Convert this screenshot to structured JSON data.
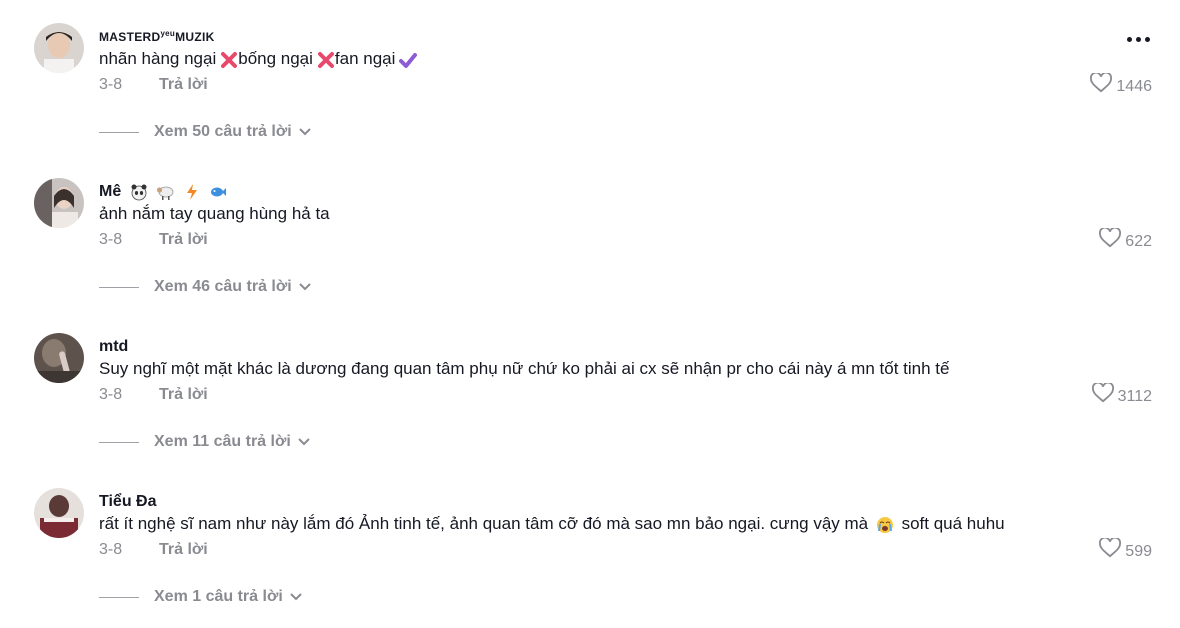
{
  "comments": [
    {
      "username": "MASTERD",
      "username_sup": "yeu",
      "username_tail": "MUZIK",
      "text_parts": [
        "nhãn hàng ngại",
        "bống ngại",
        "fan ngại"
      ],
      "date": "3-8",
      "reply_label": "Trả lời",
      "likes": "1446",
      "view_replies": "Xem 50 câu trả lời",
      "emojis": [
        "cross-mark",
        "cross-mark",
        "check-mark"
      ]
    },
    {
      "username": "Mê",
      "username_emojis": [
        "panda",
        "sheep",
        "lightning",
        "fish"
      ],
      "text": "ảnh nắm tay quang hùng hả ta",
      "date": "3-8",
      "reply_label": "Trả lời",
      "likes": "622",
      "view_replies": "Xem 46 câu trả lời"
    },
    {
      "username": "mtd",
      "text": "Suy nghĩ một mặt khác là dương đang quan tâm phụ nữ chứ ko phải ai cx sẽ nhận pr cho cái này á mn tốt tinh tế",
      "date": "3-8",
      "reply_label": "Trả lời",
      "likes": "3112",
      "view_replies": "Xem 11 câu trả lời"
    },
    {
      "username": "Tiểu Đa",
      "text_before": "rất ít nghệ sĩ nam như này lắm đó Ảnh tinh tế, ảnh quan tâm cỡ đó mà sao mn bảo ngại. cưng vậy mà",
      "text_after": "soft quá huhu",
      "emojis": [
        "crying-face"
      ],
      "date": "3-8",
      "reply_label": "Trả lời",
      "likes": "599",
      "view_replies": "Xem 1 câu trả lời"
    }
  ],
  "colors": {
    "text": "#161823",
    "muted": "#8a8b91",
    "cross": "#e8486b",
    "check": "#8c5cd6"
  },
  "more_menu": "more-options-icon"
}
